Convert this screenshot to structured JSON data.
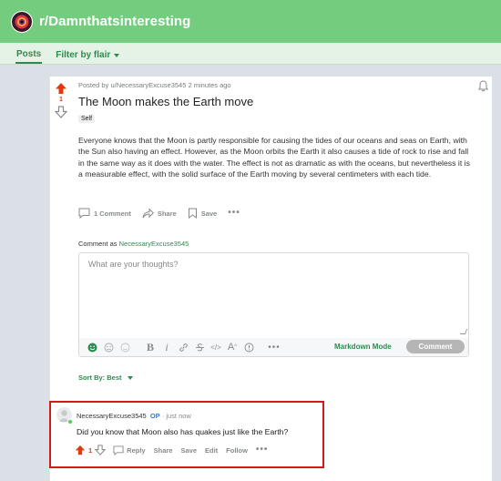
{
  "subreddit": {
    "name": "r/Damnthatsinteresting"
  },
  "subnav": {
    "tabs": [
      "Posts"
    ],
    "filter_label": "Filter by flair"
  },
  "post": {
    "score": "1",
    "meta": "Posted by u/NecessaryExcuse3545 2 minutes ago",
    "title": "The Moon makes the Earth move",
    "flair": "Self",
    "body": "Everyone knows that the Moon is partly responsible for causing the tides of our oceans and seas on Earth, with the Sun also having an effect. However, as the Moon orbits the Earth it also causes a tide of rock to rise and fall in the same way as it does with the water. The effect is not as dramatic as with the oceans, but nevertheless it is a measurable effect, with the solid surface of the Earth moving by several centimeters with each tide.",
    "actions": {
      "comments": "1 Comment",
      "share": "Share",
      "save": "Save",
      "more": "•••"
    }
  },
  "composer": {
    "comment_as_prefix": "Comment as ",
    "username": "NecessaryExcuse3545",
    "placeholder": "What are your thoughts?",
    "markdown_mode": "Markdown Mode",
    "submit_label": "Comment"
  },
  "sort": {
    "label": "Sort By: Best"
  },
  "comment": {
    "author": "NecessaryExcuse3545",
    "op_badge": "OP",
    "time": "· just now",
    "text": "Did you know that Moon also has quakes just like the Earth?",
    "score": "1",
    "actions": {
      "reply": "Reply",
      "share": "Share",
      "save": "Save",
      "edit": "Edit",
      "follow": "Follow",
      "more": "•••"
    }
  },
  "colors": {
    "brand": "#74cd7f",
    "accent": "#2e8b4f",
    "upvote": "#e03a12",
    "highlight_border": "#d11a1a"
  },
  "icons": [
    "subreddit-avatar-icon",
    "upvote-icon",
    "downvote-icon",
    "bell-icon",
    "comment-icon",
    "share-icon",
    "bookmark-icon",
    "emoji-icon",
    "bold-icon",
    "italic-icon",
    "link-icon",
    "strikethrough-icon",
    "code-icon",
    "superscript-icon",
    "spoiler-icon",
    "avatar-icon"
  ]
}
